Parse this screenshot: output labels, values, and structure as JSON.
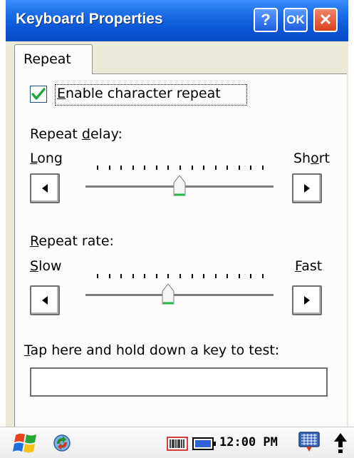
{
  "window": {
    "title": "Keyboard Properties",
    "help_label": "?",
    "ok_label": "OK",
    "close_label": "✕"
  },
  "tabs": [
    {
      "label": "Repeat",
      "selected": true
    }
  ],
  "repeat": {
    "enable_checkbox": {
      "label": "Enable character repeat",
      "checked": true
    },
    "delay": {
      "label": "Repeat delay:",
      "min_label": "Long",
      "max_label": "Short",
      "value": 0.5,
      "tick_count": 15
    },
    "rate": {
      "label": "Repeat rate:",
      "min_label": "Slow",
      "max_label": "Fast",
      "value": 0.43,
      "tick_count": 15
    },
    "test": {
      "label": "Tap here and hold down a key to test:",
      "value": ""
    }
  },
  "taskbar": {
    "clock": "12:00 PM",
    "icons": [
      "start-windows-logo-icon",
      "sync-icon",
      "barcode-scanner-icon",
      "battery-icon",
      "input-panel-icon",
      "up-arrow-icon"
    ]
  },
  "colors": {
    "titlebar": "#0a55d6",
    "dialog_background": "#ece9d8",
    "page_background": "#fcfcfc",
    "check_green": "#1fa83a",
    "close_red": "#d9431f"
  }
}
